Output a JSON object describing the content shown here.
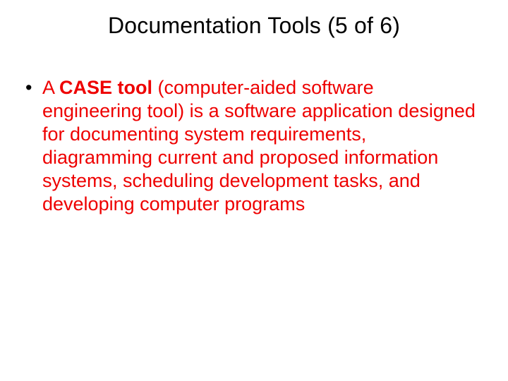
{
  "title": "Documentation Tools (5 of 6)",
  "bullet": {
    "prefix": "A ",
    "term": "CASE tool",
    "rest": " (computer-aided software engineering tool) is a software application designed for documenting system requirements, diagramming current and proposed information systems, scheduling development tasks, and developing computer programs"
  }
}
